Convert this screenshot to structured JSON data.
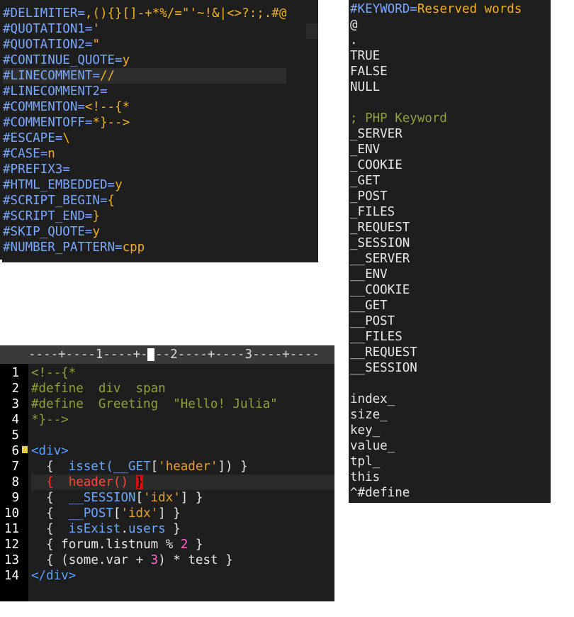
{
  "settings": {
    "lines": [
      {
        "key": "#DELIMITER",
        "value": ",(){}[]-+*%/=\"'~!&|<>?:;.#@"
      },
      {
        "key": "#QUOTATION1",
        "value": "'"
      },
      {
        "key": "#QUOTATION2",
        "value": "\""
      },
      {
        "key": "#CONTINUE_QUOTE",
        "value": "y"
      },
      {
        "key": "#LINECOMMENT",
        "value": "//"
      },
      {
        "key": "#LINECOMMENT2",
        "value": ""
      },
      {
        "key": "#COMMENTON",
        "value": "<!--{*"
      },
      {
        "key": "#COMMENTOFF",
        "value": "*}-->"
      },
      {
        "key": "#ESCAPE",
        "value": "\\"
      },
      {
        "key": "#CASE",
        "value": "n"
      },
      {
        "key": "#PREFIX3",
        "value": ""
      },
      {
        "key": "#HTML_EMBEDDED",
        "value": "y"
      },
      {
        "key": "#SCRIPT_BEGIN",
        "value": "{"
      },
      {
        "key": "#SCRIPT_END",
        "value": "}"
      },
      {
        "key": "#SKIP_QUOTE",
        "value": "y"
      },
      {
        "key": "#NUMBER_PATTERN",
        "value": "cpp"
      }
    ]
  },
  "keywords": {
    "header_key": "#KEYWORD",
    "header_value": "Reserved words",
    "group1": [
      "@",
      ".",
      "TRUE",
      "FALSE",
      "NULL"
    ],
    "php_comment": "; PHP Keyword",
    "group2": [
      "_SERVER",
      "_ENV",
      "_COOKIE",
      "_GET",
      "_POST",
      "_FILES",
      "_REQUEST",
      "_SESSION",
      "__SERVER",
      "__ENV",
      "__COOKIE",
      "__GET",
      "__POST",
      "__FILES",
      "__REQUEST",
      "__SESSION"
    ],
    "group3": [
      "index_",
      "size_",
      "key_",
      "value_",
      "tpl_",
      "this",
      "^#define"
    ]
  },
  "editor": {
    "ruler": "----+----1----+----2----+----3----+----",
    "line_numbers": [
      "1",
      "2",
      "3",
      "4",
      "5",
      "6",
      "7",
      "8",
      "9",
      "10",
      "11",
      "12",
      "13",
      "14"
    ],
    "code": {
      "l1": "<!--{*",
      "l2a": "#define",
      "l2b": "div",
      "l2c": "span",
      "l3a": "#define",
      "l3b": "Greeting",
      "l3c": "\"Hello! Julia\"",
      "l4": "*}-->",
      "l6": "<div>",
      "l7a": "{",
      "l7b": "isset(",
      "l7c": "__GET",
      "l7d": "[",
      "l7e": "'header'",
      "l7f": "])",
      "l7g": "}",
      "l8a": "{",
      "l8b": "header",
      "l8c": "()",
      "l8d": "}",
      "l9a": "{",
      "l9b": "__SESSION",
      "l9c": "[",
      "l9d": "'idx'",
      "l9e": "]",
      "l9f": "}",
      "l10a": "{",
      "l10b": "__POST",
      "l10c": "[",
      "l10d": "'idx'",
      "l10e": "]",
      "l10f": "}",
      "l11a": "{",
      "l11b": "isExist",
      "l11c": ".",
      "l11d": "users",
      "l11e": "}",
      "l12a": "{",
      "l12b": "forum",
      "l12c": ".",
      "l12d": "listnum",
      "l12e": "%",
      "l12f": "2",
      "l12g": "}",
      "l13a": "{",
      "l13b": "(some",
      "l13c": ".",
      "l13d": "var",
      "l13e": "+",
      "l13f": "3",
      "l13g": ")",
      "l13h": "*",
      "l13i": "test",
      "l13j": "}",
      "l14": "</div>"
    }
  },
  "colors": {
    "background": "#1e1e1e",
    "key_blue": "#79a7ff",
    "value_orange": "#f0b020",
    "comment_olive": "#8fa03a",
    "number_pink": "#ff66cc",
    "highlight_red": "#ff3030"
  }
}
